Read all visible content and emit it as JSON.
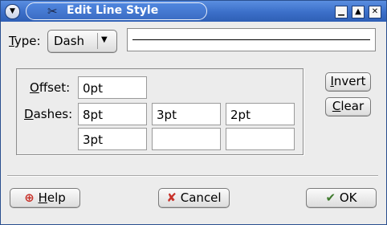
{
  "window": {
    "title": "Edit Line Style",
    "menu_icon": "chevron-down-icon",
    "title_icon": "scissors-icon",
    "controls": [
      "minimize-icon",
      "maximize-icon",
      "close-icon"
    ]
  },
  "type": {
    "label_underlined": "T",
    "label_rest": "ype:",
    "selected": "Dash"
  },
  "dashes_frame": {
    "offset_label_underlined": "O",
    "offset_label_rest": "ffset:",
    "offset_value": "0pt",
    "dashes_label_underlined": "D",
    "dashes_label_rest": "ashes:",
    "dash_values": [
      "8pt",
      "3pt",
      "2pt",
      "3pt",
      "",
      ""
    ]
  },
  "side_buttons": {
    "invert_underlined": "I",
    "invert_rest": "nvert",
    "clear_underlined": "C",
    "clear_rest": "lear"
  },
  "footer": {
    "help_underlined": "H",
    "help_rest": "elp",
    "cancel_label": "Cancel",
    "ok_label": "OK"
  }
}
